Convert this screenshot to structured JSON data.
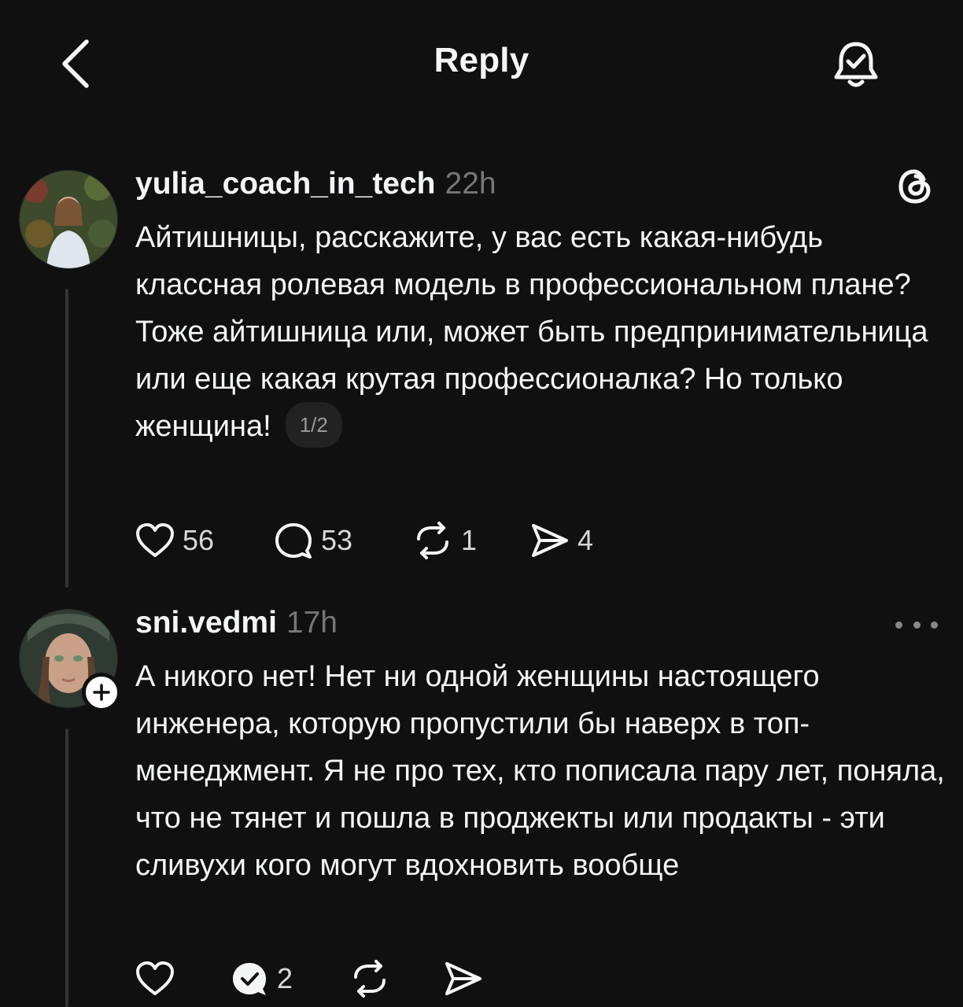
{
  "header": {
    "title": "Reply"
  },
  "posts": [
    {
      "username": "yulia_coach_in_tech",
      "time": "22h",
      "text": "Айтишницы, расскажите, у вас есть какая-нибудь классная ролевая модель в профессиональном плане? Тоже айтишница или, может быть предпринимательница или еще какая крутая профессионалка? Но только женщина!",
      "pager": "1/2",
      "likes": "56",
      "comments": "53",
      "reposts": "1",
      "shares": "4"
    },
    {
      "username": "sni.vedmi",
      "time": "17h",
      "text": "А никого нет! Нет ни одной женщины настоящего инженера, которую пропустили бы наверх в топ-менеджмент. Я не про тех, кто пописала пару лет, поняла, что не тянет и пошла в проджекты или продакты - эти сливухи кого могут вдохновить вообще",
      "comments": "2"
    }
  ],
  "icons": {
    "back": "chevron-left-icon",
    "notifications": "bell-check-icon",
    "threads": "threads-logo-icon",
    "like": "heart-icon",
    "comment": "speech-bubble-icon",
    "repost": "repost-icon",
    "share": "send-icon",
    "more": "more-dots-icon",
    "follow": "plus-icon"
  },
  "colors": {
    "background": "#101010",
    "text": "#f3f5f7",
    "muted": "#777777"
  }
}
